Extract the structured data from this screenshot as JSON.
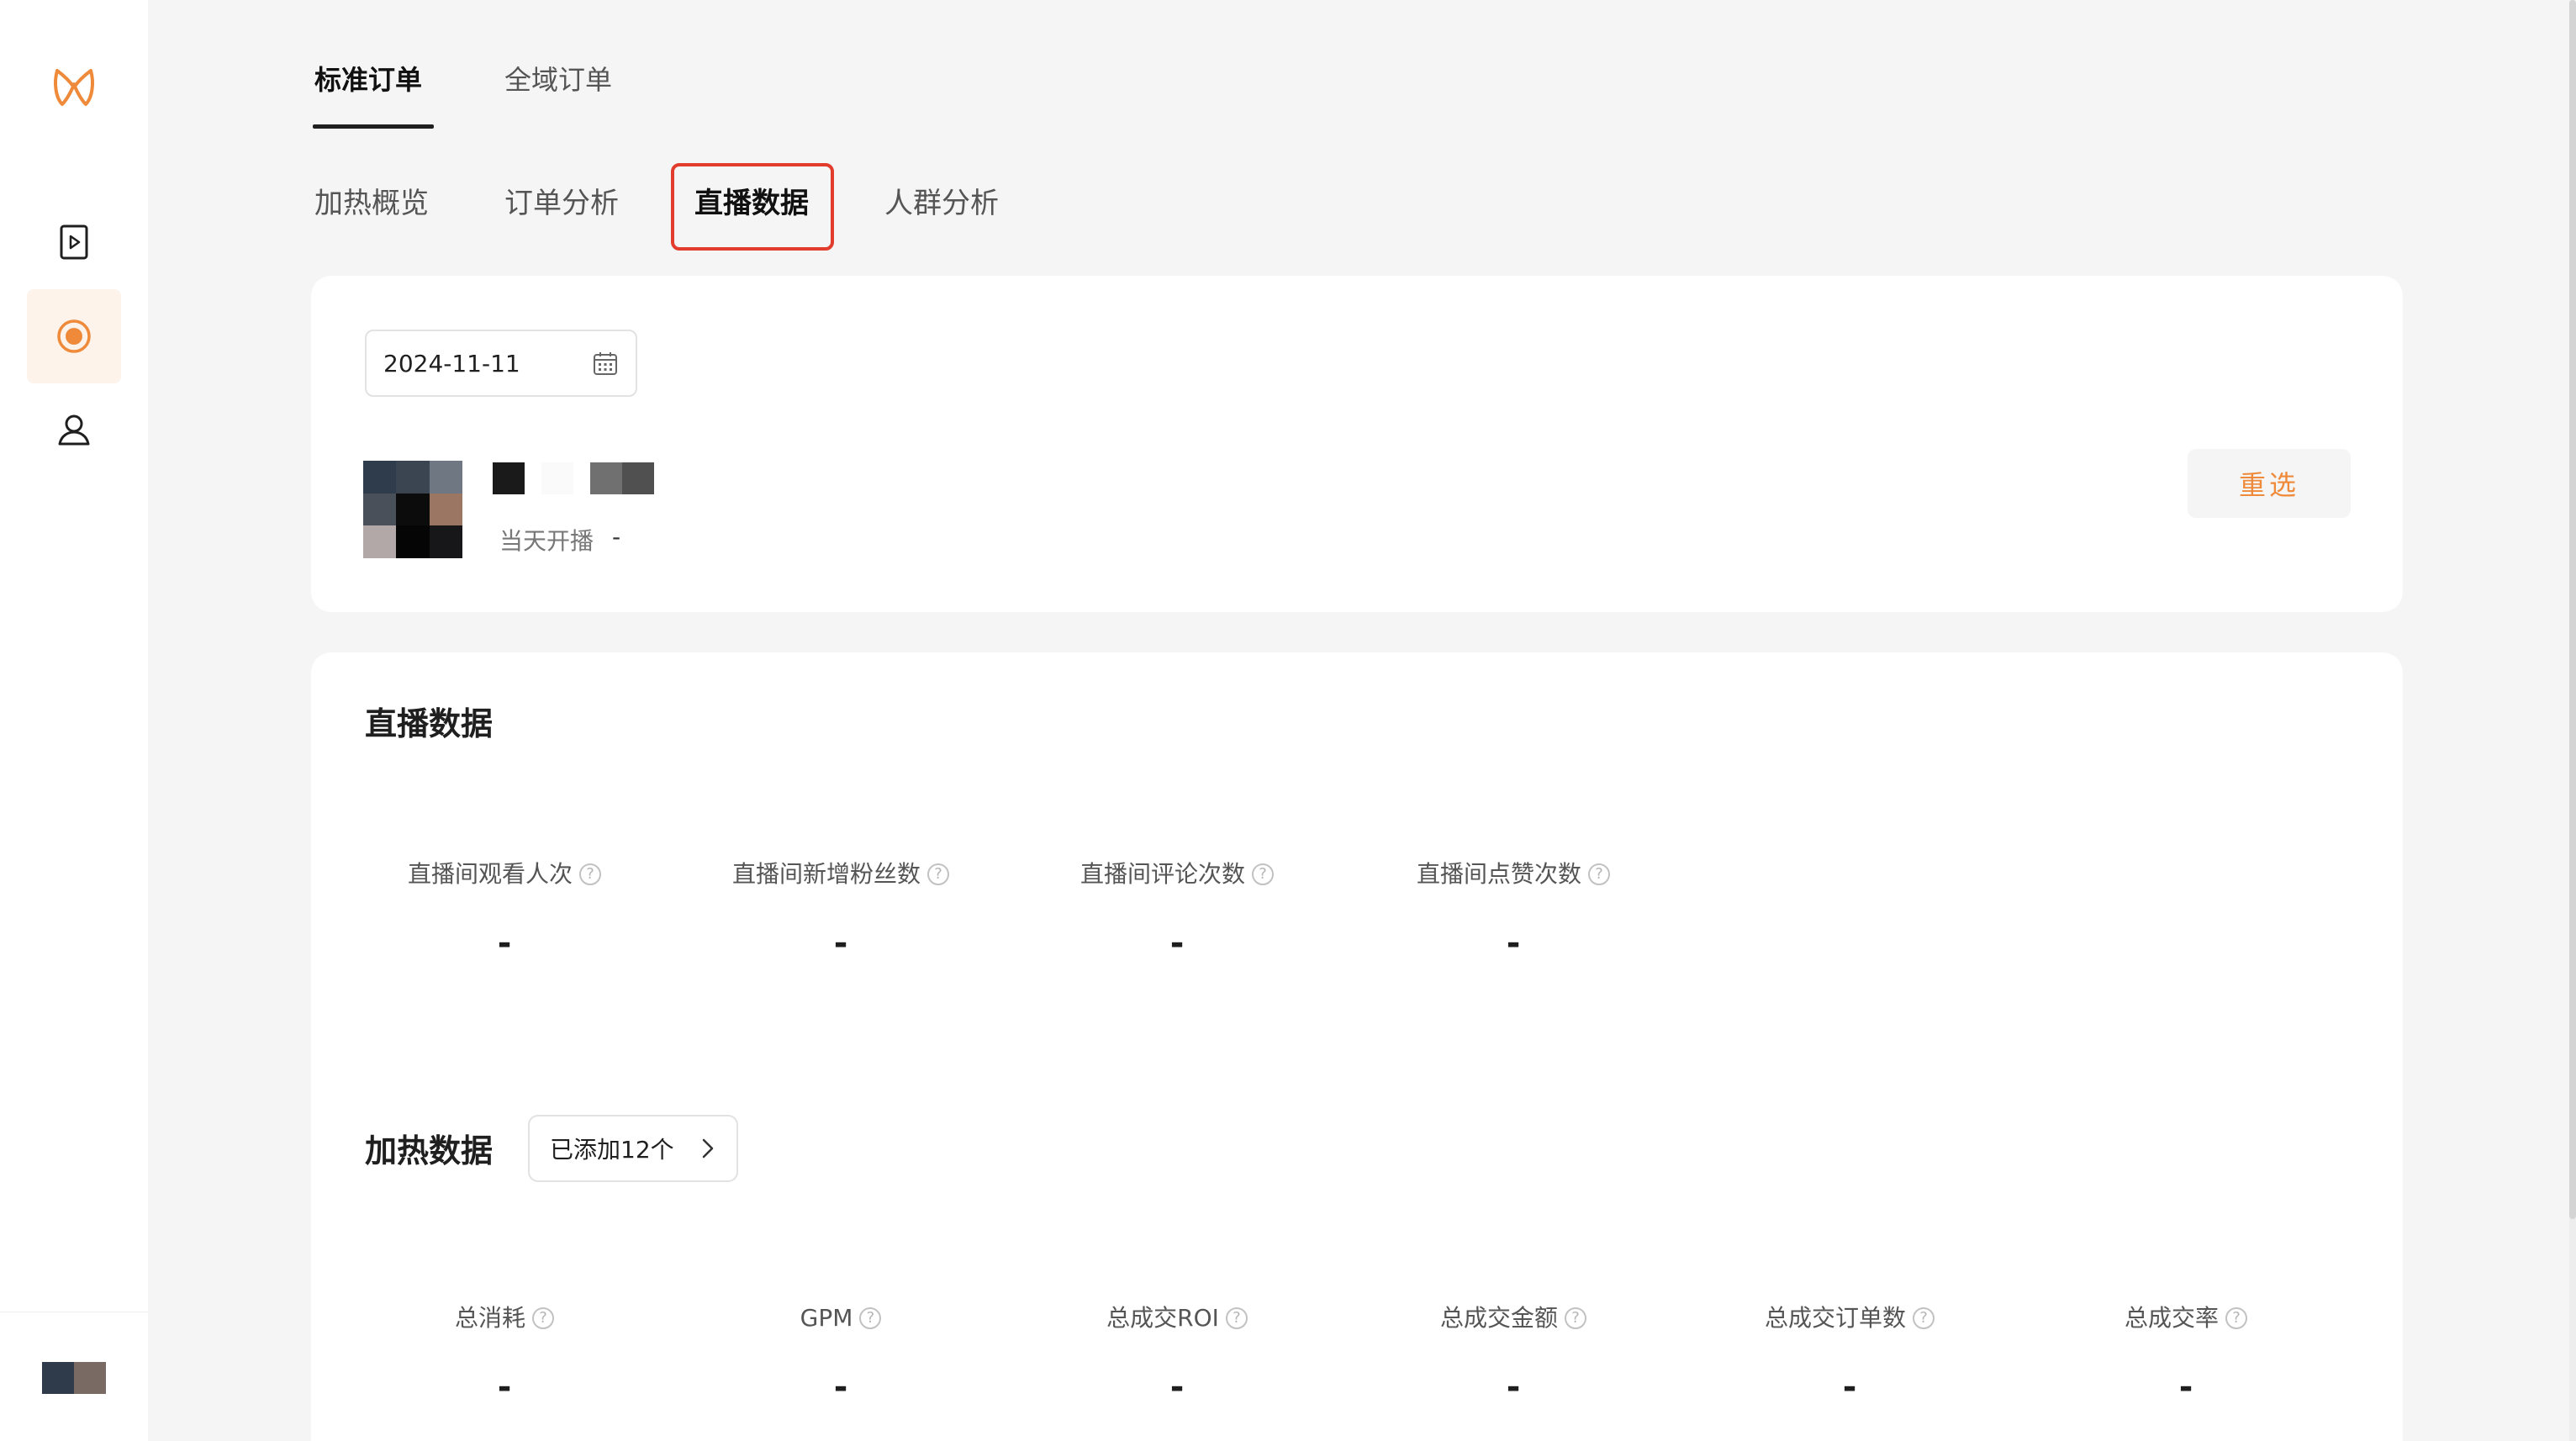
{
  "tabs_primary": [
    {
      "label": "标准订单",
      "active": true
    },
    {
      "label": "全域订单",
      "active": false
    }
  ],
  "tabs_secondary": [
    {
      "label": "加热概览",
      "active": false
    },
    {
      "label": "订单分析",
      "active": false
    },
    {
      "label": "直播数据",
      "active": true
    },
    {
      "label": "人群分析",
      "active": false
    }
  ],
  "filter": {
    "date": "2024-11-11",
    "status_label": "当天开播",
    "status_value": "-",
    "reselect_label": "重选"
  },
  "live_section": {
    "title": "直播数据",
    "metrics": [
      {
        "label": "直播间观看人次",
        "value": "-"
      },
      {
        "label": "直播间新增粉丝数",
        "value": "-"
      },
      {
        "label": "直播间评论次数",
        "value": "-"
      },
      {
        "label": "直播间点赞次数",
        "value": "-"
      }
    ]
  },
  "heat_section": {
    "title": "加热数据",
    "added_label": "已添加12个",
    "metrics": [
      {
        "label": "总消耗",
        "value": "-"
      },
      {
        "label": "GPM",
        "value": "-"
      },
      {
        "label": "总成交ROI",
        "value": "-"
      },
      {
        "label": "总成交金额",
        "value": "-"
      },
      {
        "label": "总成交订单数",
        "value": "-"
      },
      {
        "label": "总成交率",
        "value": "-"
      }
    ]
  },
  "help_glyph": "?",
  "colors": {
    "accent": "#ee8a3a",
    "highlight_border": "#e13c2c",
    "active_nav_bg": "#fdf3ea"
  }
}
